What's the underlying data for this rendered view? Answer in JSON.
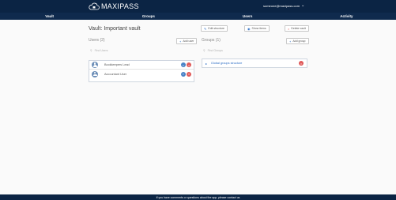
{
  "header": {
    "logo_text": "MAXIPASS",
    "user_email": "someone@maxipass.com"
  },
  "nav": [
    {
      "label": "Vault"
    },
    {
      "label": "Groups"
    },
    {
      "label": "Users"
    },
    {
      "label": "Activity"
    }
  ],
  "vault": {
    "title": "Vault: Important vault",
    "actions": {
      "edit_structure": "Edit structure",
      "show_items": "Show items",
      "delete_vault": "Delete vault"
    }
  },
  "users": {
    "title": "Users (2)",
    "add_button": "Add user",
    "filter_placeholder": "Find Users",
    "items": [
      {
        "name": "Bookkeepers Lead"
      },
      {
        "name": "Accountant User"
      }
    ]
  },
  "groups": {
    "title": "Groups (1)",
    "add_button": "Add group",
    "filter_placeholder": "Find Groups",
    "items": [
      {
        "name": "Global groups structure"
      }
    ]
  },
  "footer": {
    "text": "If you have comments or questions about the app, please contact us"
  },
  "colors": {
    "header_bg": "#0b2444",
    "nav_bg": "#0f2a4d",
    "accent": "#2a6cc4",
    "danger": "#e05a5a"
  }
}
